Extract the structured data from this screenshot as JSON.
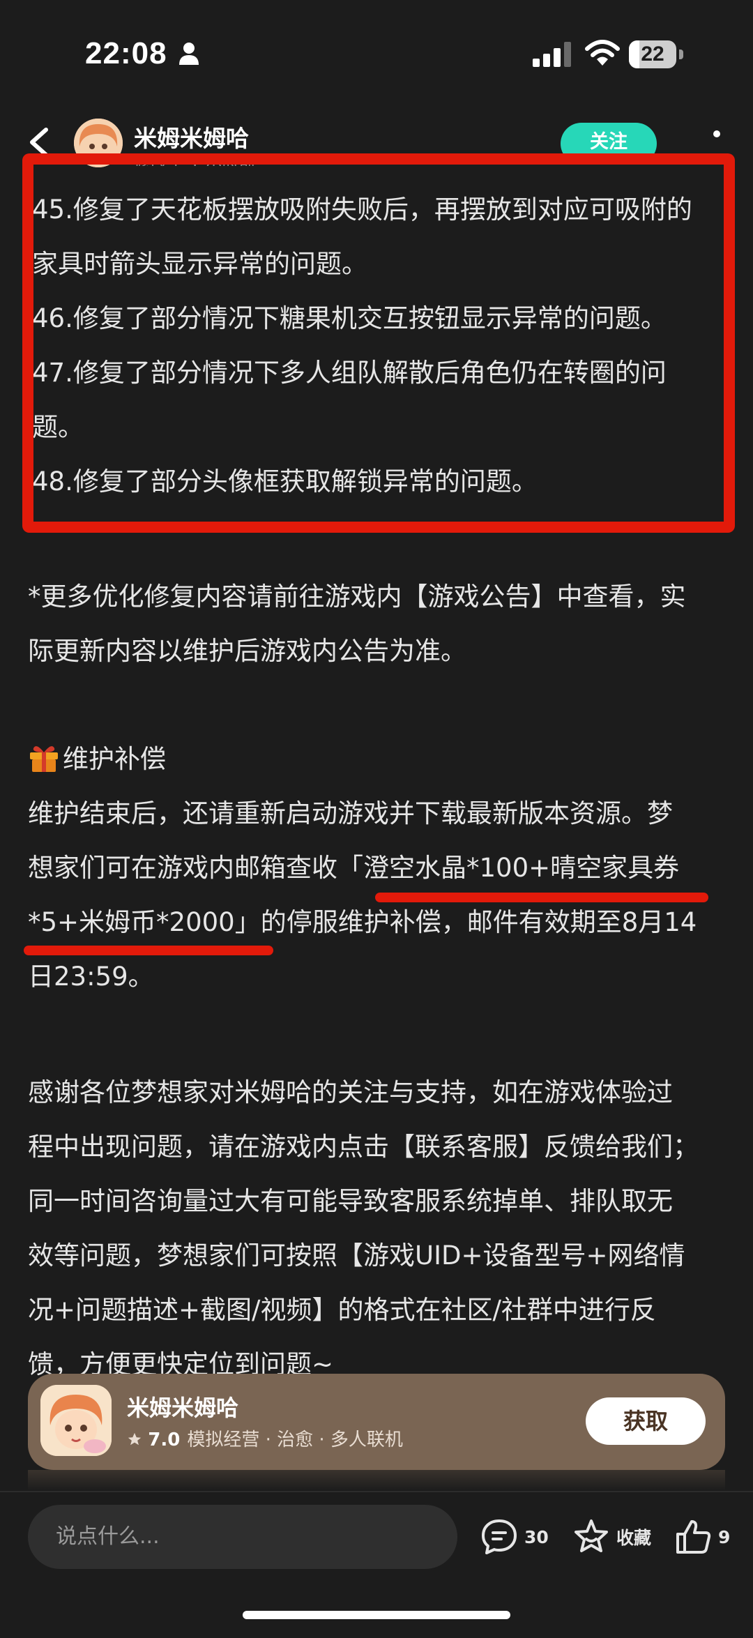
{
  "status_bar": {
    "time": "22:08",
    "battery": "22",
    "battery_fraction": 0.22
  },
  "header": {
    "author_name": "米姆米姆哈",
    "subtitle": "修改于 1 小时前",
    "follow_label": "关注"
  },
  "article": {
    "fixes": [
      "45.修复了天花板摆放吸附失败后，再摆放到对应可吸附的",
      "家具时箭头显示异常的问题。",
      "46.修复了部分情况下糖果机交互按钮显示异常的问题。",
      "47.修复了部分情况下多人组队解散后角色仍在转圈的问",
      "题。",
      "48.修复了部分头像框获取解锁异常的问题。"
    ],
    "note_lines": [
      "*更多优化修复内容请前往游戏内【游戏公告】中查看，实",
      "际更新内容以维护后游戏内公告为准。"
    ],
    "compensation_title": "维护补偿",
    "compensation_lines": [
      "维护结束后，还请重新启动游戏并下载最新版本资源。梦",
      "想家们可在游戏内邮箱查收「澄空水晶*100+晴空家具券",
      "*5+米姆币*2000」的停服维护补偿，邮件有效期至8月14",
      "日23:59。"
    ],
    "thanks_lines": [
      "感谢各位梦想家对米姆哈的关注与支持，如在游戏体验过",
      "程中出现问题，请在游戏内点击【联系客服】反馈给我们；",
      "同一时间咨询量过大有可能导致客服系统掉单、排队取无",
      "效等问题，梦想家们可按照【游戏UID+设备型号+网络情",
      "况+问题描述+截图/视频】的格式在社区/社群中进行反",
      "馈，方便更快定位到问题~"
    ]
  },
  "game_card": {
    "name": "米姆米姆哈",
    "rating": "7.0",
    "tags": "模拟经营 · 治愈 · 多人联机",
    "get_label": "获取"
  },
  "bottom_bar": {
    "comment_placeholder": "说点什么...",
    "comment_count": "30",
    "favorite_label": "收藏",
    "like_count": "9"
  },
  "colors": {
    "background": "#1c1c1c",
    "highlight_red": "#e21a0a",
    "follow_teal": "#27d7b8",
    "card_brown": "#7a6553"
  },
  "icons": [
    "person-icon",
    "signal-icon",
    "wifi-icon",
    "battery-icon",
    "back-icon",
    "more-icon",
    "gift-icon",
    "star-icon",
    "comment-icon",
    "favorite-icon",
    "like-icon"
  ]
}
